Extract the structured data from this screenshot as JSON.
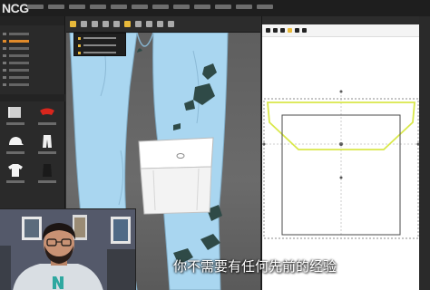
{
  "app": {
    "logo_text": "NCG",
    "menu_item_count": 12
  },
  "library": {
    "tree_rows": [
      {
        "selected": false
      },
      {
        "selected": true
      },
      {
        "selected": false
      },
      {
        "selected": false
      },
      {
        "selected": false
      },
      {
        "selected": false
      },
      {
        "selected": false
      },
      {
        "selected": false
      }
    ],
    "thumbnails": [
      {
        "icon": "folder-icon"
      },
      {
        "icon": "red-garment-icon"
      },
      {
        "icon": "cap-icon"
      },
      {
        "icon": "pants-icon"
      },
      {
        "icon": "tshirt-icon"
      },
      {
        "icon": "dark-garment-icon"
      }
    ]
  },
  "viewport3d": {
    "dropdown_options": [
      {
        "icon": "option-icon"
      },
      {
        "icon": "option-icon"
      },
      {
        "icon": "option-icon"
      }
    ],
    "garment": "jeans-with-cargo-pockets"
  },
  "pattern2d": {
    "pieces": [
      "pocket-flap",
      "pocket-body"
    ]
  },
  "webcam": {
    "subject": "presenter"
  },
  "subtitle": {
    "text": "你不需要有任何先前的经验"
  },
  "colors": {
    "accent": "#e8b93a",
    "selection": "#e08a2a",
    "garment": "#a9d6f0",
    "flap_outline": "#d9e84a"
  }
}
